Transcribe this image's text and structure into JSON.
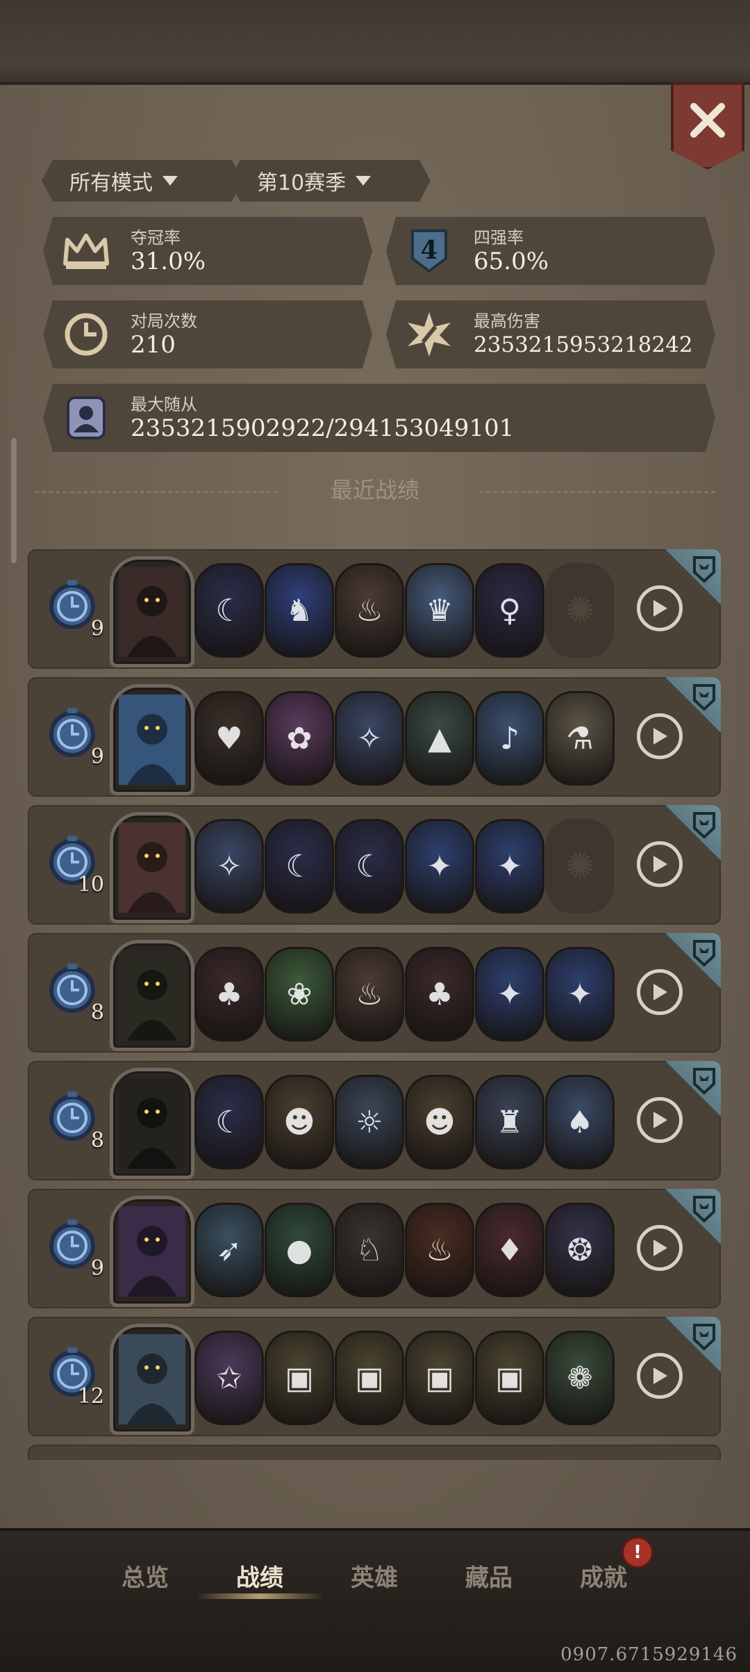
{
  "filters": {
    "mode": "所有模式",
    "season": "第10赛季"
  },
  "stats": {
    "win_rate": {
      "label": "夺冠率",
      "value": "31.0%"
    },
    "top4_rate": {
      "label": "四强率",
      "value": "65.0%",
      "icon_text": "4"
    },
    "games": {
      "label": "对局次数",
      "value": "210"
    },
    "max_damage": {
      "label": "最高伤害",
      "value": "2353215953218242"
    },
    "max_minion": {
      "label": "最大随从",
      "value": "2353215902922/294153049101"
    }
  },
  "section_title": "最近战绩",
  "matches": [
    {
      "round": "9",
      "hero_color": "#3a2a28",
      "minions": [
        {
          "icon": "moon-witch",
          "color": "#2b2d4a"
        },
        {
          "icon": "blue-dragon",
          "color": "#2f3f7a"
        },
        {
          "icon": "chef",
          "color": "#4a3b34"
        },
        {
          "icon": "king",
          "color": "#465a7a"
        },
        {
          "icon": "dark-lady",
          "color": "#2c2a45"
        },
        {
          "icon": "empty-slot",
          "color": "#3f372f"
        }
      ]
    },
    {
      "round": "9",
      "hero_color": "#35557a",
      "minions": [
        {
          "icon": "bear-toy",
          "color": "#3a302a"
        },
        {
          "icon": "pink-fairy",
          "color": "#5a3b5e"
        },
        {
          "icon": "wizard",
          "color": "#3a4664"
        },
        {
          "icon": "shark-totem",
          "color": "#3a4a44"
        },
        {
          "icon": "goose",
          "color": "#3a5070"
        },
        {
          "icon": "mad-scientist",
          "color": "#5b5446"
        }
      ]
    },
    {
      "round": "10",
      "hero_color": "#4a3230",
      "minions": [
        {
          "icon": "wizard",
          "color": "#3a4664"
        },
        {
          "icon": "moon-witch",
          "color": "#2b2d4a"
        },
        {
          "icon": "moon-witch",
          "color": "#2b2d4a"
        },
        {
          "icon": "blue-sorceress",
          "color": "#2e3f6e"
        },
        {
          "icon": "blue-sorceress",
          "color": "#2e3f6e"
        },
        {
          "icon": "empty-slot",
          "color": "#3f372f"
        }
      ]
    },
    {
      "round": "8",
      "hero_color": "#2b2a22",
      "minions": [
        {
          "icon": "elf-archer",
          "color": "#3b2a2a"
        },
        {
          "icon": "green-maid",
          "color": "#3c5a3a"
        },
        {
          "icon": "chef",
          "color": "#4a3b34"
        },
        {
          "icon": "elf-archer",
          "color": "#3b2a2a"
        },
        {
          "icon": "blue-sorceress",
          "color": "#2e3f6e"
        },
        {
          "icon": "blue-sorceress",
          "color": "#2e3f6e"
        }
      ]
    },
    {
      "round": "8",
      "hero_color": "#24221e",
      "minions": [
        {
          "icon": "moon-witch",
          "color": "#2b2d4a"
        },
        {
          "icon": "scarecrow",
          "color": "#4a3f30"
        },
        {
          "icon": "lamp-robot",
          "color": "#3a4658"
        },
        {
          "icon": "scarecrow",
          "color": "#4a3f30"
        },
        {
          "icon": "gold-mage",
          "color": "#3a4256"
        },
        {
          "icon": "elf-queen",
          "color": "#3a4a66"
        }
      ]
    },
    {
      "round": "9",
      "hero_color": "#3a2c48",
      "minions": [
        {
          "icon": "pelican",
          "color": "#3a5060"
        },
        {
          "icon": "green-slime",
          "color": "#2f4a3a"
        },
        {
          "icon": "bunny-knight",
          "color": "#3a332e"
        },
        {
          "icon": "fire-unicorn",
          "color": "#4a2c22"
        },
        {
          "icon": "jester",
          "color": "#4a2a2e"
        },
        {
          "icon": "kraken",
          "color": "#35324a"
        }
      ]
    },
    {
      "round": "12",
      "hero_color": "#3a4a58",
      "minions": [
        {
          "icon": "witch-girl",
          "color": "#4a3a5a"
        },
        {
          "icon": "book-mimic",
          "color": "#4a4430"
        },
        {
          "icon": "book-mimic",
          "color": "#4a4430"
        },
        {
          "icon": "book-mimic",
          "color": "#4a4430"
        },
        {
          "icon": "book-mimic",
          "color": "#4a4430"
        },
        {
          "icon": "rose-lady",
          "color": "#3a4a3a"
        }
      ]
    }
  ],
  "glyphs": {
    "moon-witch": "☾",
    "blue-dragon": "♞",
    "chef": "♨",
    "king": "♛",
    "dark-lady": "♀",
    "empty-slot": "✺",
    "bear-toy": "♥",
    "pink-fairy": "✿",
    "wizard": "✧",
    "shark-totem": "▲",
    "goose": "♪",
    "mad-scientist": "⚗",
    "blue-sorceress": "✦",
    "elf-archer": "♣",
    "green-maid": "❀",
    "scarecrow": "☻",
    "lamp-robot": "☼",
    "gold-mage": "♜",
    "elf-queen": "♠",
    "pelican": "➶",
    "green-slime": "●",
    "bunny-knight": "♘",
    "fire-unicorn": "♨",
    "jester": "♦",
    "kraken": "❂",
    "witch-girl": "✩",
    "book-mimic": "▣",
    "rose-lady": "❁"
  },
  "nav": {
    "overview": "总览",
    "records": "战绩",
    "heroes": "英雄",
    "collection": "藏品",
    "achievements": "成就",
    "alert": "!"
  },
  "watermark": "0907.6715929146"
}
